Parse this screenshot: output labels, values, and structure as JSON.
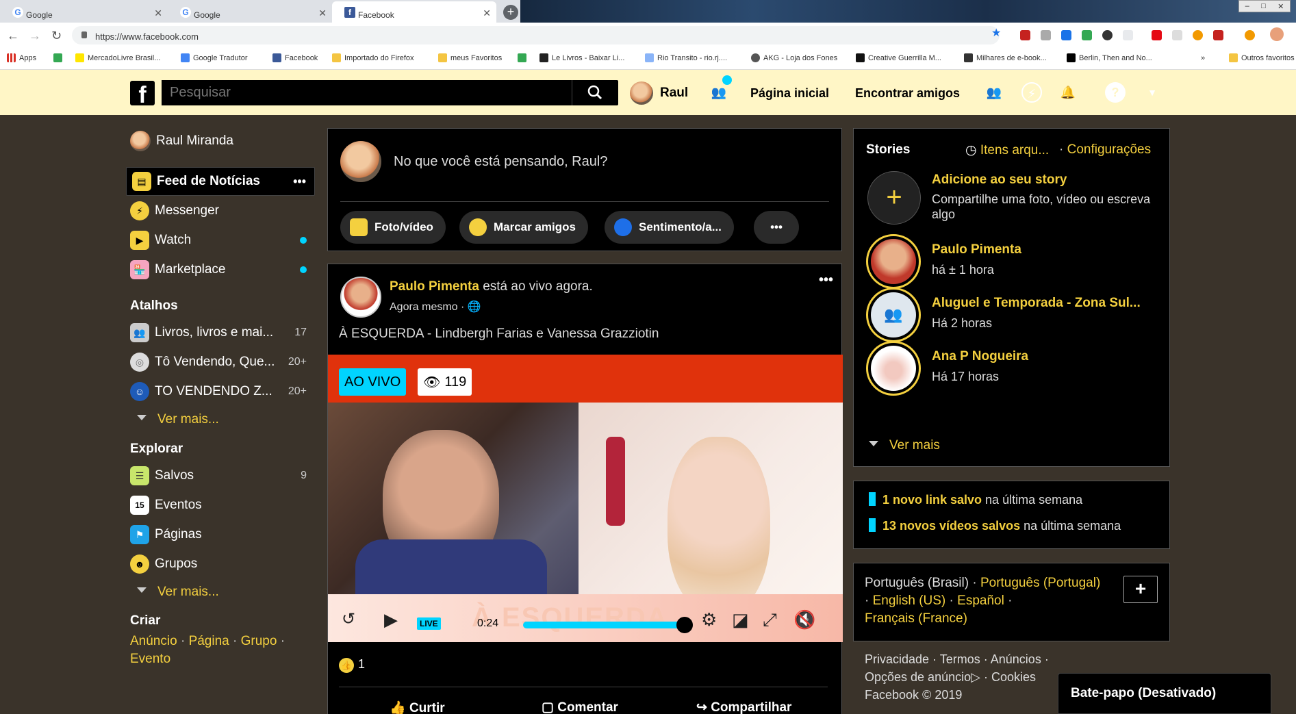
{
  "browser": {
    "tabs": [
      {
        "title": "Google",
        "icon": "google-icon"
      },
      {
        "title": "Google",
        "icon": "google-icon"
      },
      {
        "title": "Facebook",
        "icon": "facebook-icon"
      }
    ],
    "url": "https://www.facebook.com",
    "bookmarks": [
      "Apps",
      "MercadoLivre Brasil...",
      "Google Tradutor",
      "Facebook",
      "Importado do Firefox",
      "meus Favoritos",
      "Le Livros - Baixar Li...",
      "Rio Transito - rio.rj....",
      "AKG - Loja dos Fones",
      "Creative Guerrilla M...",
      "Milhares de e-book...",
      "Berlin, Then and No...",
      "»",
      "Outros favoritos"
    ]
  },
  "header": {
    "search_placeholder": "Pesquisar",
    "user_name": "Raul",
    "home_link": "Página inicial",
    "find_friends_link": "Encontrar amigos",
    "theme_color": "#fff6c6"
  },
  "left_nav": {
    "profile_name": "Raul Miranda",
    "items": [
      {
        "label": "Feed de Notícias",
        "more": "•••"
      },
      {
        "label": "Messenger"
      },
      {
        "label": "Watch"
      },
      {
        "label": "Marketplace"
      }
    ],
    "shortcuts_title": "Atalhos",
    "shortcuts": [
      {
        "label": "Livros, livros e mai...",
        "count": "17"
      },
      {
        "label": "Tô Vendendo, Que...",
        "count": "20+"
      },
      {
        "label": "TO VENDENDO Z...",
        "count": "20+"
      }
    ],
    "see_more": "Ver mais...",
    "explore_title": "Explorar",
    "explore": [
      {
        "label": "Salvos",
        "count": "9"
      },
      {
        "label": "Eventos"
      },
      {
        "label": "Páginas"
      },
      {
        "label": "Grupos"
      }
    ],
    "create_title": "Criar",
    "create_links": [
      "Anúncio",
      "Página",
      "Grupo",
      "Evento"
    ]
  },
  "composer": {
    "prompt": "No que você está pensando, Raul?",
    "actions": [
      "Foto/vídeo",
      "Marcar amigos",
      "Sentimento/a...",
      "•••"
    ]
  },
  "post": {
    "author": "Paulo Pimenta",
    "status": "está ao vivo agora.",
    "time": "Agora mesmo",
    "text": "À ESQUERDA - Lindbergh Farias e Vanessa Grazziotin",
    "live_label": "AO VIVO",
    "viewers": "119",
    "live_chip": "LIVE",
    "timestamp": "0:24",
    "overlay_text": "À ESQUERDA",
    "progress": 0.95,
    "likes": "1",
    "buttons": [
      "Curtir",
      "Comentar",
      "Compartilhar"
    ]
  },
  "stories": {
    "title": "Stories",
    "archive": "Itens arqu...",
    "settings": "Configurações",
    "add_title": "Adicione ao seu story",
    "add_sub": "Compartilhe uma foto, vídeo ou escreva algo",
    "items": [
      {
        "name": "Paulo Pimenta",
        "time": "há ± 1 hora"
      },
      {
        "name": "Aluguel e Temporada - Zona Sul...",
        "time": "Há 2 horas"
      },
      {
        "name": "Ana P Nogueira",
        "time": "Há 17 horas"
      }
    ],
    "see_more": "Ver mais"
  },
  "saved": [
    {
      "bold": "1 novo link salvo",
      "rest": " na última semana"
    },
    {
      "bold": "13 novos vídeos salvos",
      "rest": " na última semana"
    }
  ],
  "languages": {
    "current": "Português (Brasil)",
    "options": [
      "Português (Portugal)",
      "English (US)",
      "Español",
      "Français (France)"
    ],
    "add": "+"
  },
  "footer": {
    "links": [
      "Privacidade",
      "Termos",
      "Anúncios",
      "Opções de anúncio",
      "Cookies"
    ],
    "copyright": "Facebook © 2019"
  },
  "chat": {
    "label": "Bate-papo (Desativado)"
  }
}
